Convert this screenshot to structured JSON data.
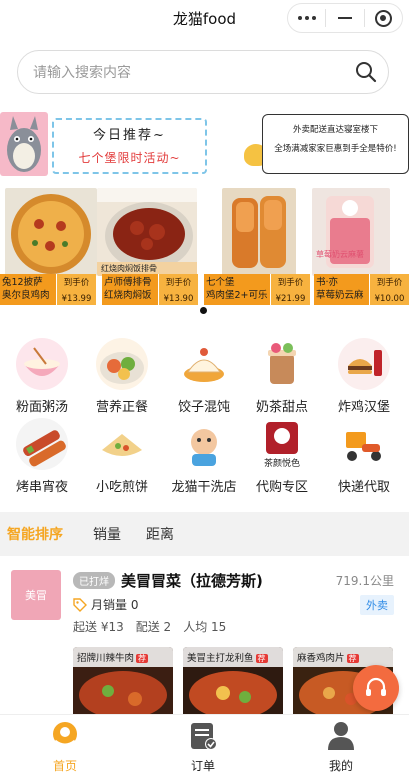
{
  "app": {
    "title": "龙猫food"
  },
  "search": {
    "placeholder": "请输入搜索内容"
  },
  "banner": {
    "today_title": "今日推荐~",
    "today_sub": "七个堡限时活动~",
    "notice_line1": "外卖配送直达寝室楼下",
    "notice_line2": "全场满减家家巨惠到手全是特价!",
    "cards": [
      {
        "name_line1": "兔12披萨",
        "name_line2": "奥尔良鸡肉",
        "tag": "到手价",
        "price": "¥13.99"
      },
      {
        "name_line1": "卢师傅排骨",
        "name_line2": "红烧肉焖饭",
        "tag": "到手价",
        "price": "¥13.90"
      },
      {
        "name_line1": "七个堡",
        "name_line2": "鸡肉堡2+可乐",
        "tag": "到手价",
        "price": "¥21.99"
      },
      {
        "name_line1": "书·亦",
        "name_line2": "草莓奶云麻",
        "tag": "到手价",
        "price": "¥10.00"
      }
    ],
    "card3_overlay": "红烧肉焖饭排骨",
    "card4_overlay": "草莓奶云麻薯"
  },
  "categories": [
    {
      "label": "粉面粥汤",
      "icon": "noodle-bowl-icon"
    },
    {
      "label": "营养正餐",
      "icon": "meal-plate-icon"
    },
    {
      "label": "饺子混饨",
      "icon": "dumpling-icon"
    },
    {
      "label": "奶茶甜点",
      "icon": "milk-tea-icon"
    },
    {
      "label": "炸鸡汉堡",
      "icon": "burger-icon"
    },
    {
      "label": "烤串宵夜",
      "icon": "skewer-icon"
    },
    {
      "label": "小吃煎饼",
      "icon": "pancake-icon"
    },
    {
      "label": "龙猫干洗店",
      "icon": "laundry-icon"
    },
    {
      "label": "代购专区",
      "icon": "shopping-icon"
    },
    {
      "label": "快递代取",
      "icon": "delivery-icon"
    }
  ],
  "sort": {
    "items": [
      "智能排序",
      "销量",
      "距离"
    ],
    "active": "智能排序"
  },
  "shop": {
    "logo_text": "美冒",
    "status": "已打烊",
    "name": "美冒冒菜（拉德芳斯)",
    "distance": "719.1公里",
    "monthly_sales": "月销量 0",
    "delivery_type": "外卖",
    "min_order": "起送 ¥13",
    "delivery_fee": "配送 2",
    "avg_price": "人均 15",
    "dishes": [
      {
        "name": "招牌川辣牛肉",
        "badge": "荐"
      },
      {
        "name": "美冒主打龙利鱼",
        "badge": "荐"
      },
      {
        "name": "麻香鸡肉片",
        "badge": "荐"
      }
    ]
  },
  "tabs": [
    {
      "label": "首页",
      "active": true
    },
    {
      "label": "订单",
      "active": false
    },
    {
      "label": "我的",
      "active": false
    }
  ],
  "colors": {
    "accent": "#f5a623",
    "price_strip": "#f39a1d",
    "blue_tag": "#2f8be6",
    "cs_button": "#f36b3f"
  }
}
